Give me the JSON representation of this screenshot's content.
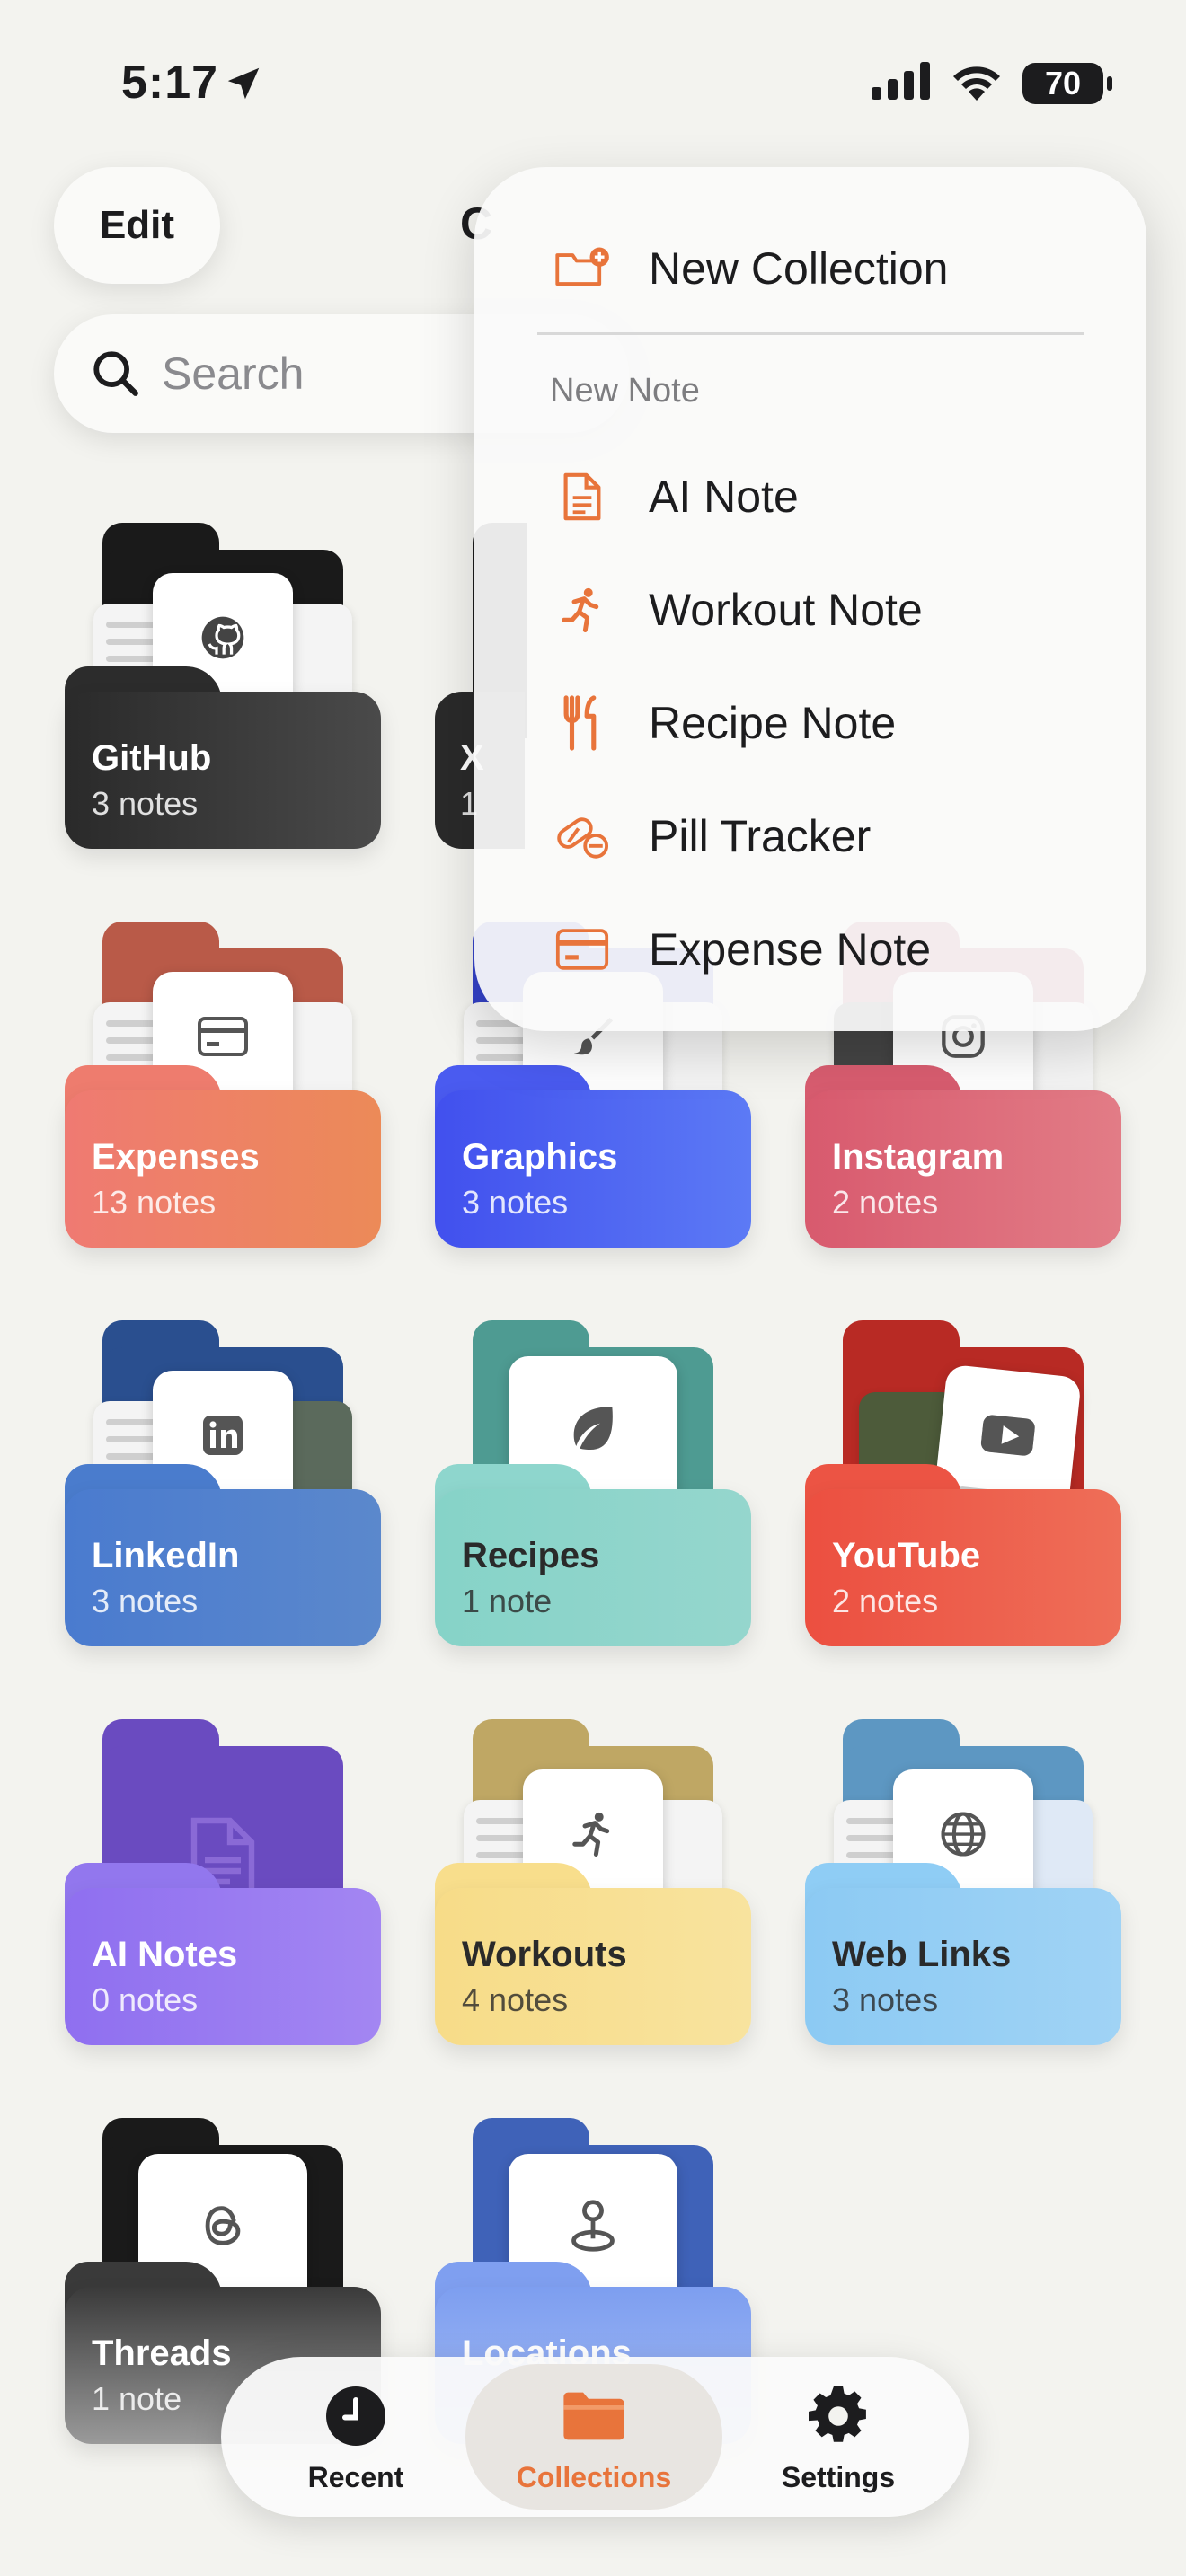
{
  "status_bar": {
    "time": "5:17",
    "battery": "70"
  },
  "header": {
    "edit_label": "Edit",
    "title_fragment": "C"
  },
  "search": {
    "placeholder": "Search"
  },
  "colors": {
    "accent": "#E8743B"
  },
  "collections": [
    {
      "name": "GitHub",
      "count": "3 notes",
      "icon": "github-icon"
    },
    {
      "name": "X",
      "count": "1",
      "icon": "x-icon"
    },
    {
      "name": "Expenses",
      "count": "13 notes",
      "icon": "card-icon"
    },
    {
      "name": "Graphics",
      "count": "3 notes",
      "icon": "brush-icon"
    },
    {
      "name": "Instagram",
      "count": "2 notes",
      "icon": "instagram-icon"
    },
    {
      "name": "LinkedIn",
      "count": "3 notes",
      "icon": "linkedin-icon"
    },
    {
      "name": "Recipes",
      "count": "1 note",
      "icon": "leaf-icon"
    },
    {
      "name": "YouTube",
      "count": "2 notes",
      "icon": "youtube-icon"
    },
    {
      "name": "AI Notes",
      "count": "0 notes",
      "icon": "document-icon"
    },
    {
      "name": "Workouts",
      "count": "4 notes",
      "icon": "runner-icon"
    },
    {
      "name": "Web Links",
      "count": "3 notes",
      "icon": "globe-icon"
    },
    {
      "name": "Threads",
      "count": "1 note",
      "icon": "threads-icon"
    },
    {
      "name": "Locations",
      "count": "",
      "icon": "map-pin-icon"
    }
  ],
  "menu": {
    "new_collection": "New Collection",
    "section_label": "New Note",
    "items": [
      {
        "label": "AI Note",
        "icon": "document-icon"
      },
      {
        "label": "Workout Note",
        "icon": "runner-icon"
      },
      {
        "label": "Recipe Note",
        "icon": "fork-knife-icon"
      },
      {
        "label": "Pill Tracker",
        "icon": "pill-icon"
      },
      {
        "label": "Expense Note",
        "icon": "card-icon"
      }
    ]
  },
  "tabbar": {
    "tabs": [
      {
        "label": "Recent",
        "icon": "clock-icon"
      },
      {
        "label": "Collections",
        "icon": "folder-icon"
      },
      {
        "label": "Settings",
        "icon": "gear-icon"
      }
    ]
  }
}
